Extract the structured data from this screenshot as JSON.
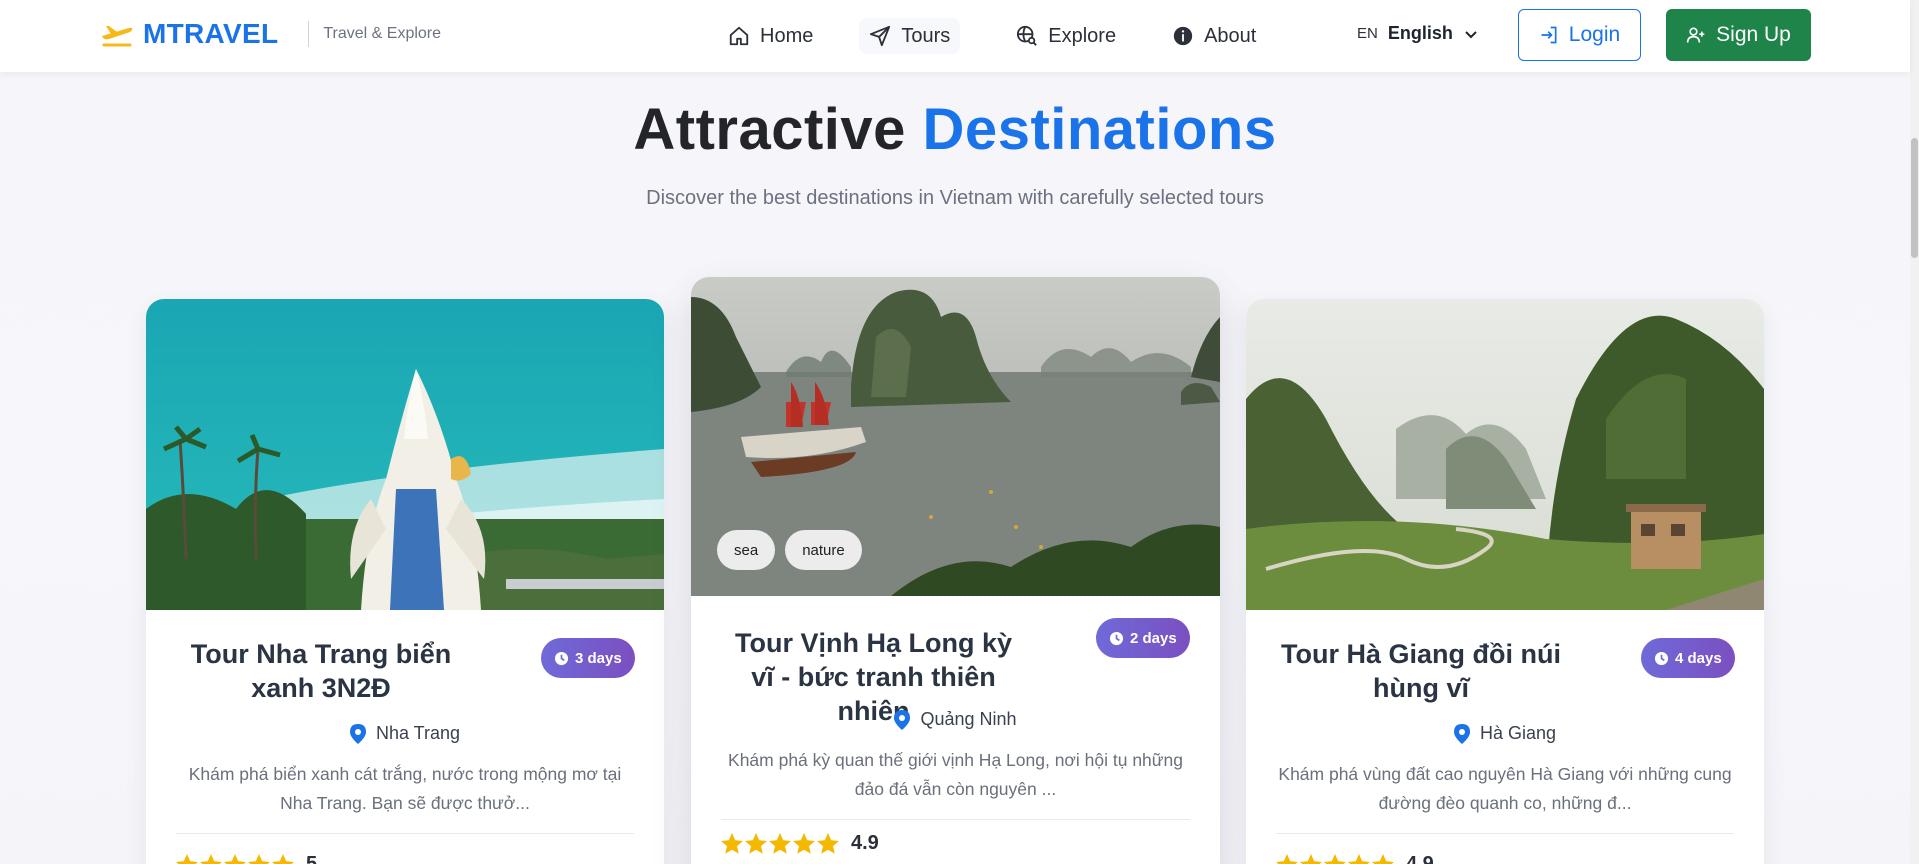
{
  "brand": {
    "name": "MTRAVEL",
    "tagline": "Travel & Explore",
    "accent_color": "#1a73e8",
    "logo_icon": "plane-icon"
  },
  "nav": {
    "items": [
      {
        "label": "Home",
        "icon": "home-icon"
      },
      {
        "label": "Tours",
        "icon": "send-icon"
      },
      {
        "label": "Explore",
        "icon": "globe-search-icon"
      },
      {
        "label": "About",
        "icon": "info-icon"
      }
    ]
  },
  "language": {
    "code": "EN",
    "name": "English"
  },
  "auth": {
    "login_label": "Login",
    "signup_label": "Sign Up",
    "signup_color": "#1e8449"
  },
  "section": {
    "title_main": "Attractive",
    "title_accent": "Destinations",
    "subtitle": "Discover the best destinations in Vietnam with carefully selected tours"
  },
  "tours": [
    {
      "title": "Tour Nha Trang biển xanh 3N2Đ",
      "duration": "3 days",
      "location": "Nha Trang",
      "description": "Khám phá biển xanh cát trắng, nước trong mộng mơ tại Nha Trang. Bạn sẽ được thưở...",
      "rating": 5,
      "rating_label": "5",
      "tags": []
    },
    {
      "title": "Tour Vịnh Hạ Long kỳ vĩ - bức tranh thiên nhiên",
      "duration": "2 days",
      "location": "Quảng Ninh",
      "description": "Khám phá kỳ quan thế giới vịnh Hạ Long, nơi hội tụ những đảo đá vẫn còn nguyên ...",
      "rating": 4.9,
      "rating_label": "4.9",
      "tags": [
        "sea",
        "nature"
      ]
    },
    {
      "title": "Tour Hà Giang đồi núi hùng vĩ",
      "duration": "4 days",
      "location": "Hà Giang",
      "description": "Khám phá vùng đất cao nguyên Hà Giang với những cung đường đèo quanh co, những đ...",
      "rating": 4.9,
      "rating_label": "4.9",
      "tags": []
    }
  ]
}
